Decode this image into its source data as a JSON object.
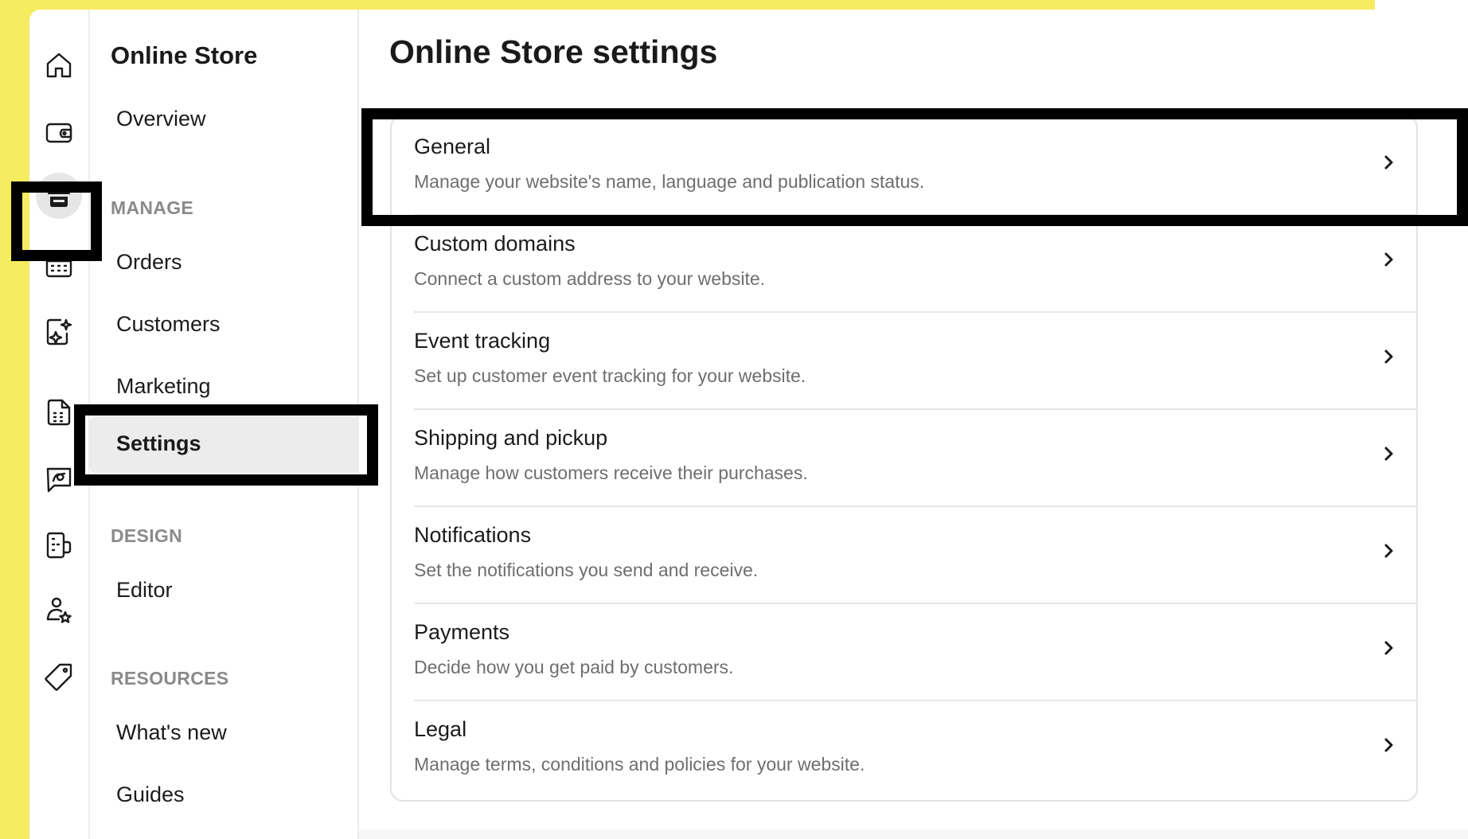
{
  "icons": {
    "rail": [
      "home-icon",
      "wallet-icon",
      "store-icon",
      "calendar-icon",
      "sparkle-icon",
      "invoice-icon",
      "chat-icon",
      "device-icon",
      "user-star-icon",
      "tag-icon"
    ],
    "chevron": "chevron-right-icon"
  },
  "sidebar": {
    "title": "Online Store",
    "overview": "Overview",
    "manage_heading": "MANAGE",
    "manage_items": [
      "Orders",
      "Customers",
      "Marketing",
      "Settings"
    ],
    "design_heading": "DESIGN",
    "design_items": [
      "Editor"
    ],
    "resources_heading": "RESOURCES",
    "resources_items": [
      "What's new",
      "Guides"
    ]
  },
  "main": {
    "title": "Online Store settings",
    "rows": [
      {
        "title": "General",
        "description": "Manage your website's name, language and publication status."
      },
      {
        "title": "Custom domains",
        "description": "Connect a custom address to your website."
      },
      {
        "title": "Event tracking",
        "description": "Set up customer event tracking for your website."
      },
      {
        "title": "Shipping and pickup",
        "description": "Manage how customers receive their purchases."
      },
      {
        "title": "Notifications",
        "description": "Set the notifications you send and receive."
      },
      {
        "title": "Payments",
        "description": "Decide how you get paid by customers."
      },
      {
        "title": "Legal",
        "description": "Manage terms, conditions and policies for your website."
      }
    ]
  },
  "colors": {
    "background_yellow": "#f6ec5f",
    "selected_bg": "#ececec",
    "highlight_border": "#000000"
  }
}
